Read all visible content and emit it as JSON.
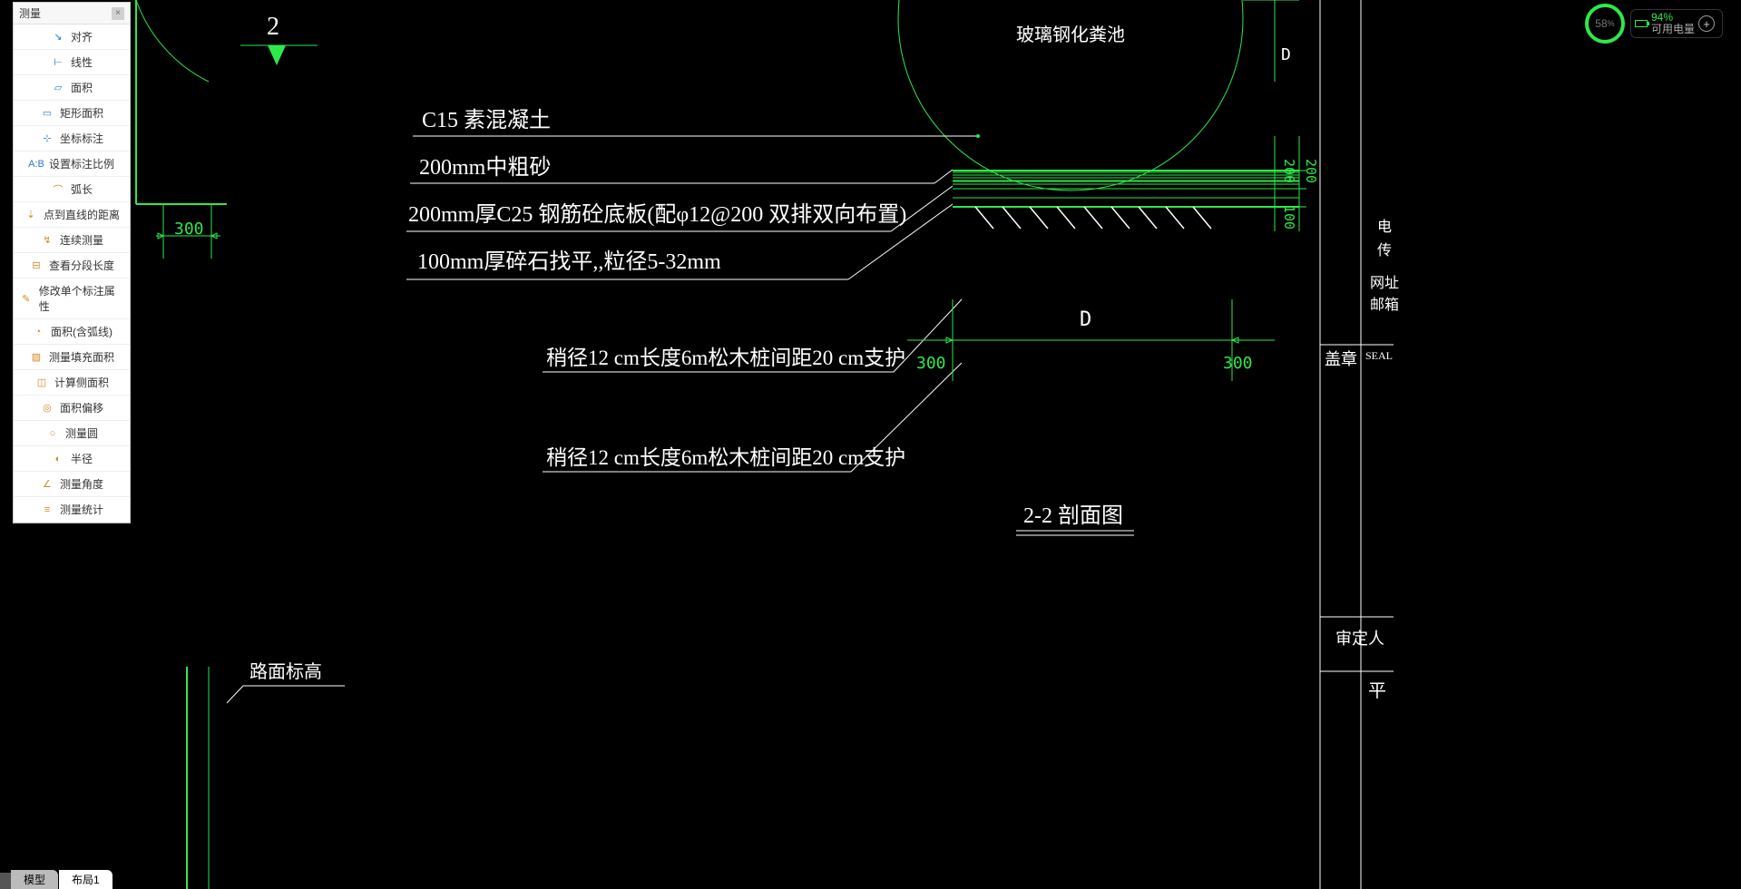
{
  "palette": {
    "title": "测量",
    "items": [
      {
        "label": "对齐",
        "icon": "align-icon",
        "iconClass": "ic-blue",
        "glyph": "↘"
      },
      {
        "label": "线性",
        "icon": "linear-icon",
        "iconClass": "ic-blue",
        "glyph": "⊢"
      },
      {
        "label": "面积",
        "icon": "area-icon",
        "iconClass": "ic-blue",
        "glyph": "▱"
      },
      {
        "label": "矩形面积",
        "icon": "rect-area-icon",
        "iconClass": "ic-blue",
        "glyph": "▭"
      },
      {
        "label": "坐标标注",
        "icon": "coord-icon",
        "iconClass": "ic-blue",
        "glyph": "⊹"
      },
      {
        "label": "设置标注比例",
        "icon": "scale-icon",
        "iconClass": "ic-blue",
        "glyph": "A:B"
      },
      {
        "label": "弧长",
        "icon": "arclen-icon",
        "iconClass": "ic-orange",
        "glyph": "⌒"
      },
      {
        "label": "点到直线的距离",
        "icon": "pt-line-icon",
        "iconClass": "ic-orange",
        "glyph": "⇣"
      },
      {
        "label": "连续测量",
        "icon": "continuous-icon",
        "iconClass": "ic-orange",
        "glyph": "↯"
      },
      {
        "label": "查看分段长度",
        "icon": "segment-len-icon",
        "iconClass": "ic-orange",
        "glyph": "⊟"
      },
      {
        "label": "修改单个标注属性",
        "icon": "edit-dim-icon",
        "iconClass": "ic-orange",
        "glyph": "✎"
      },
      {
        "label": "面积(含弧线)",
        "icon": "area-arc-icon",
        "iconClass": "ic-orange",
        "glyph": "◔"
      },
      {
        "label": "测量填充面积",
        "icon": "hatch-area-icon",
        "iconClass": "ic-orange",
        "glyph": "▨"
      },
      {
        "label": "计算侧面积",
        "icon": "side-area-icon",
        "iconClass": "ic-orange",
        "glyph": "◫"
      },
      {
        "label": "面积偏移",
        "icon": "area-offset-icon",
        "iconClass": "ic-orange",
        "glyph": "◎"
      },
      {
        "label": "测量圆",
        "icon": "circle-icon",
        "iconClass": "ic-orange",
        "glyph": "○"
      },
      {
        "label": "半径",
        "icon": "radius-icon",
        "iconClass": "ic-orange",
        "glyph": "◐"
      },
      {
        "label": "测量角度",
        "icon": "angle-icon",
        "iconClass": "ic-orange",
        "glyph": "∠"
      },
      {
        "label": "测量统计",
        "icon": "stats-icon",
        "iconClass": "ic-orange",
        "glyph": "≡"
      }
    ]
  },
  "battery": {
    "ring": "58",
    "ringUnit": "%",
    "pct": "94%",
    "label": "可用电量"
  },
  "tabs": {
    "model": "模型",
    "layout1": "布局1"
  },
  "drawing": {
    "section_mark": "2",
    "tank_label": "玻璃钢化粪池",
    "layers": {
      "l1": "C15 素混凝土",
      "l2": "200mm中粗砂",
      "l3": "200mm厚C25 钢筋砼底板(配φ12@200 双排双向布置)",
      "l4": "100mm厚碎石找平,,粒径5-32mm"
    },
    "piles": {
      "p1": "稍径12 cm长度6m松木桩间距20 cm支护",
      "p2": "稍径12 cm长度6m松木桩间距20 cm支护"
    },
    "section_title": "2-2 剖面图",
    "road_elev": "路面标高",
    "dims": {
      "d300_left": "300",
      "d300_a": "300",
      "d300_b": "300",
      "d200_a": "200",
      "d200_b": "200",
      "d100": "100",
      "letter_D_top": "D",
      "letter_D_mid": "D"
    },
    "titleblock": {
      "tel": "电",
      "fax": "传",
      "web": "网址",
      "mail": "邮箱",
      "seal": "盖章",
      "seal_en": "SEAL",
      "approver": "审定人",
      "ping": "平"
    }
  }
}
